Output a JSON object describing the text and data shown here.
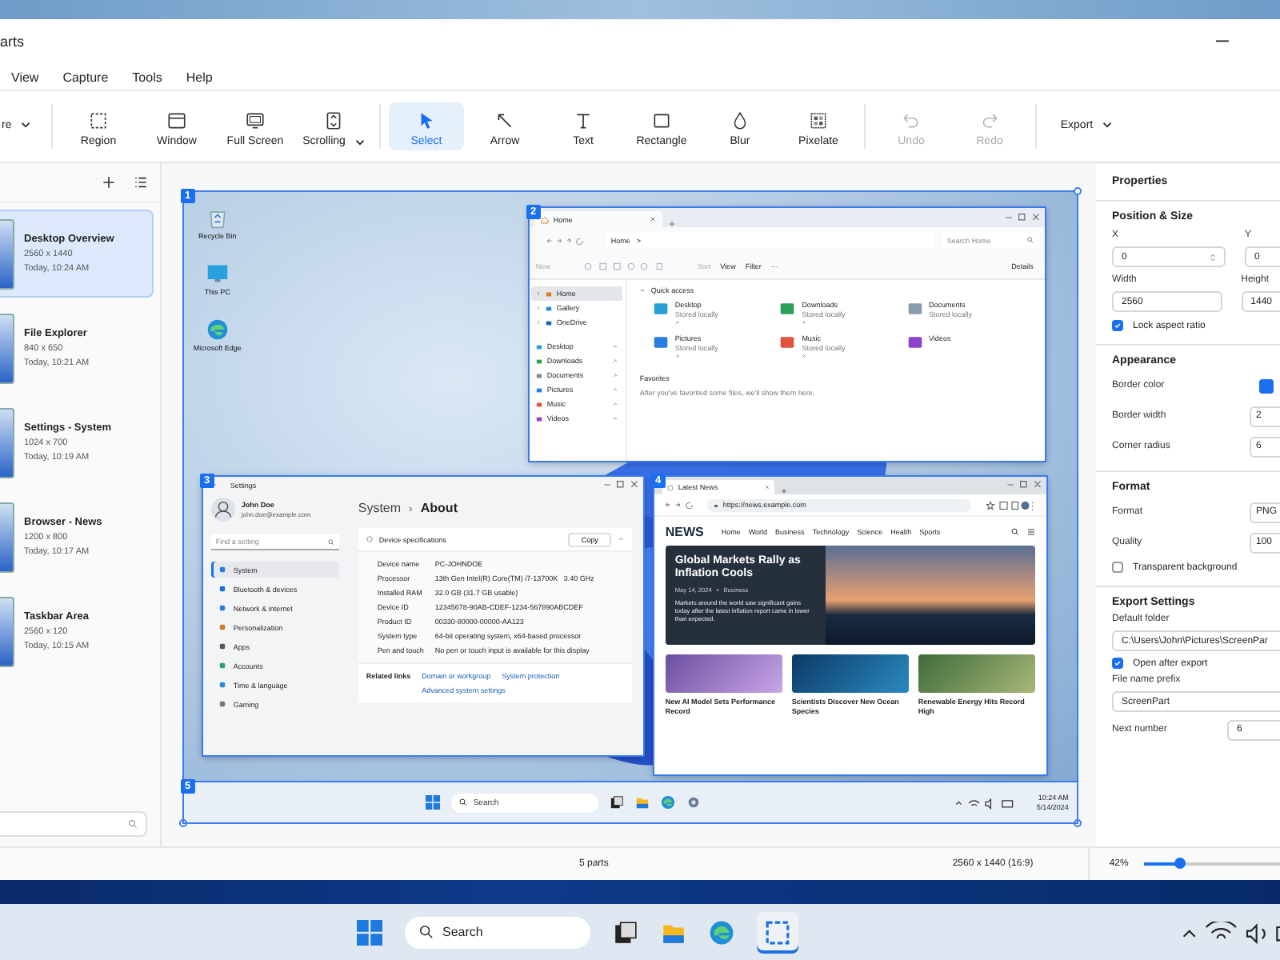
{
  "app": {
    "title": "arts"
  },
  "menu": [
    "View",
    "Capture",
    "Tools",
    "Help"
  ],
  "toolbar": [
    [
      {
        "label": "re",
        "dropdown": true,
        "selected": false,
        "disabled": false
      }
    ],
    [
      {
        "label": "Region",
        "dropdown": false,
        "selected": false,
        "disabled": false
      },
      {
        "label": "Window",
        "dropdown": false,
        "selected": false,
        "disabled": false
      },
      {
        "label": "Full Screen",
        "dropdown": false,
        "selected": false,
        "disabled": false
      },
      {
        "label": "Scrolling",
        "dropdown": true,
        "selected": false,
        "disabled": false
      }
    ],
    [
      {
        "label": "Select",
        "dropdown": false,
        "selected": true,
        "disabled": false
      },
      {
        "label": "Arrow",
        "dropdown": false,
        "selected": false,
        "disabled": false
      },
      {
        "label": "Text",
        "dropdown": false,
        "selected": false,
        "disabled": false
      },
      {
        "label": "Rectangle",
        "dropdown": false,
        "selected": false,
        "disabled": false
      },
      {
        "label": "Blur",
        "dropdown": false,
        "selected": false,
        "disabled": false
      },
      {
        "label": "Pixelate",
        "dropdown": false,
        "selected": false,
        "disabled": false
      }
    ],
    [
      {
        "label": "Undo",
        "dropdown": false,
        "selected": false,
        "disabled": true
      },
      {
        "label": "Redo",
        "dropdown": false,
        "selected": false,
        "disabled": true
      }
    ],
    [
      {
        "label": "Export",
        "dropdown": true,
        "selected": false,
        "disabled": false
      }
    ]
  ],
  "sidebar": {
    "items": [
      {
        "title": "Desktop Overview",
        "size": "2560 x 1440",
        "time": "Today, 10:24 AM",
        "selected": true
      },
      {
        "title": "File Explorer",
        "size": "840 x 650",
        "time": "Today, 10:21 AM",
        "selected": false
      },
      {
        "title": "Settings - System",
        "size": "1024 x 700",
        "time": "Today, 10:19 AM",
        "selected": false
      },
      {
        "title": "Browser - News",
        "size": "1200 x 800",
        "time": "Today, 10:17 AM",
        "selected": false
      },
      {
        "title": "Taskbar Area",
        "size": "2560 x 120",
        "time": "Today, 10:15 AM",
        "selected": false
      }
    ]
  },
  "canvas": {
    "parts": [
      {
        "number": "1",
        "selected": true
      },
      {
        "number": "2",
        "selected": false
      },
      {
        "number": "3",
        "selected": false
      },
      {
        "number": "4",
        "selected": false
      },
      {
        "number": "5",
        "selected": false
      }
    ],
    "desktop_icons": [
      "Recycle Bin",
      "This PC",
      "Microsoft Edge"
    ],
    "explorer": {
      "tab": "Home",
      "address": [
        "Home",
        ">"
      ],
      "search_placeholder": "Search Home",
      "commands": [
        {
          "label": "New",
          "disabled": true
        },
        {
          "label": "Sort",
          "disabled": true
        },
        {
          "label": "View",
          "disabled": false
        },
        {
          "label": "Filter",
          "disabled": false
        }
      ],
      "more": "···",
      "details": "Details",
      "nav": [
        {
          "label": "Home",
          "selected": true,
          "expandable": true,
          "pinned": false
        },
        {
          "label": "Gallery",
          "selected": false,
          "expandable": true,
          "pinned": false
        },
        {
          "label": "OneDrive",
          "selected": false,
          "expandable": true,
          "pinned": false
        },
        {
          "label": "Desktop",
          "selected": false,
          "expandable": false,
          "pinned": true
        },
        {
          "label": "Downloads",
          "selected": false,
          "expandable": false,
          "pinned": true
        },
        {
          "label": "Documents",
          "selected": false,
          "expandable": false,
          "pinned": true
        },
        {
          "label": "Pictures",
          "selected": false,
          "expandable": false,
          "pinned": true
        },
        {
          "label": "Music",
          "selected": false,
          "expandable": false,
          "pinned": true
        },
        {
          "label": "Videos",
          "selected": false,
          "expandable": false,
          "pinned": true
        }
      ],
      "quick_access": "Quick access",
      "folders": [
        {
          "name": "Desktop",
          "subtitle": "Stored locally",
          "pinned": true
        },
        {
          "name": "Downloads",
          "subtitle": "Stored locally",
          "pinned": true
        },
        {
          "name": "Documents",
          "subtitle": "Stored locally",
          "pinned": false
        },
        {
          "name": "Pictures",
          "subtitle": "Stored locally",
          "pinned": true
        },
        {
          "name": "Music",
          "subtitle": "Stored locally",
          "pinned": true
        },
        {
          "name": "Videos",
          "pinned": false
        }
      ],
      "favorites": "Favorites",
      "favorites_note": "After you've favorited some files, we'll show them here."
    },
    "settings": {
      "title": "Settings",
      "user": "John Doe",
      "email": "john.doe@example.com",
      "search_placeholder": "Find a setting",
      "nav": [
        {
          "label": "System",
          "selected": true
        },
        {
          "label": "Bluetooth & devices",
          "selected": false
        },
        {
          "label": "Network & internet",
          "selected": false
        },
        {
          "label": "Personalization",
          "selected": false
        },
        {
          "label": "Apps",
          "selected": false
        },
        {
          "label": "Accounts",
          "selected": false
        },
        {
          "label": "Time & language",
          "selected": false
        },
        {
          "label": "Gaming",
          "selected": false
        }
      ],
      "breadcrumb": [
        "System",
        "›",
        "About"
      ],
      "card_title": "Device specifications",
      "copy": "Copy",
      "specs": [
        {
          "label": "Device name",
          "value": "PC-JOHNDOE"
        },
        {
          "label": "Processor",
          "value": "13th Gen Intel(R) Core(TM) i7-13700K   3.40 GHz"
        },
        {
          "label": "Installed RAM",
          "value": "32.0 GB (31.7 GB usable)"
        },
        {
          "label": "Device ID",
          "value": "12345678-90AB-CDEF-1234-567890ABCDEF"
        },
        {
          "label": "Product ID",
          "value": "00330-80000-00000-AA123"
        },
        {
          "label": "System type",
          "value": "64-bit operating system, x64-based processor"
        },
        {
          "label": "Pen and touch",
          "value": "No pen or touch input is available for this display"
        }
      ],
      "related": "Related links",
      "links": [
        "Domain or workgroup",
        "System protection",
        "Advanced system settings"
      ]
    },
    "browser": {
      "tab": "Latest News",
      "url": "https://news.example.com",
      "logo": "NEWS",
      "nav": [
        "Home",
        "World",
        "Business",
        "Technology",
        "Science",
        "Health",
        "Sports"
      ],
      "hero": {
        "title": "Global Markets Rally as Inflation Cools",
        "date": "May 14, 2024",
        "dot": "•",
        "category": "Business",
        "body": "Markets around the world saw significant gains today after the latest inflation report came in lower than expected."
      },
      "cards": [
        "New AI Model Sets Performance Record",
        "Scientists Discover New Ocean Species",
        "Renewable Energy Hits Record High"
      ]
    },
    "taskbar": {
      "search": "Search",
      "time": "10:24 AM",
      "date": "5/14/2024"
    }
  },
  "properties": {
    "title": "Properties",
    "position": {
      "title": "Position & Size",
      "x": {
        "label": "X",
        "value": "0"
      },
      "y": {
        "label": "Y",
        "value": "0"
      },
      "width": {
        "label": "Width",
        "value": "2560"
      },
      "height": {
        "label": "Height",
        "value": "1440"
      },
      "lock": {
        "label": "Lock aspect ratio",
        "checked": true
      }
    },
    "appearance": {
      "title": "Appearance",
      "border_color": {
        "label": "Border color",
        "color": "#1a6ff0"
      },
      "border_width": {
        "label": "Border width",
        "value": "2"
      },
      "corner_radius": {
        "label": "Corner radius",
        "value": "6"
      }
    },
    "format": {
      "title": "Format",
      "format": {
        "label": "Format",
        "value": "PNG"
      },
      "quality": {
        "label": "Quality",
        "value": "100"
      },
      "transparent": {
        "label": "Transparent background",
        "checked": false
      }
    },
    "export": {
      "title": "Export Settings",
      "folder": {
        "label": "Default folder",
        "value": "C:\\Users\\John\\Pictures\\ScreenPar"
      },
      "open_after": {
        "label": "Open after export",
        "checked": true
      },
      "prefix": {
        "label": "File name prefix",
        "value": "ScreenPart"
      },
      "next": {
        "label": "Next number",
        "value": "6"
      }
    }
  },
  "status_bar": {
    "parts": "5 parts",
    "dimensions": "2560 x 1440 (16:9)",
    "zoom": "42%",
    "zoom_slider": {
      "level": 0.25
    }
  },
  "taskbar": {
    "search": "Search"
  }
}
